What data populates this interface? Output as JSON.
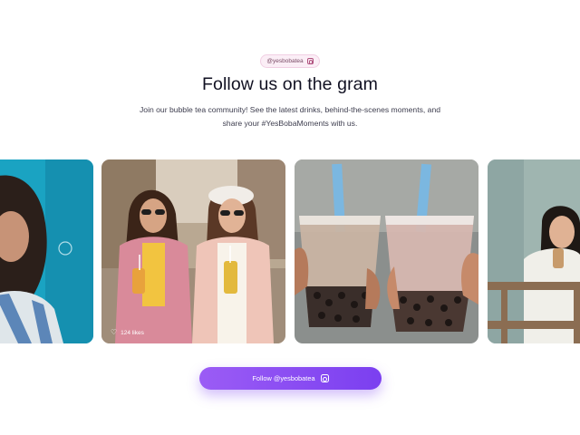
{
  "header": {
    "handle_badge": "@yesbobatea",
    "badge_icon": "instagram-icon",
    "title": "Follow us on the gram",
    "subtitle": "Join our bubble tea community! See the latest drinks, behind-the-scenes moments, and share your #YesBobaMoments with us."
  },
  "gallery": {
    "posts": [
      {
        "alt": "Woman with curly hair in denim overalls against teal background"
      },
      {
        "alt": "Two friends holding bubble tea drinks on a city street",
        "likes": "124 likes"
      },
      {
        "alt": "Two hands clinking milk bubble tea cups with blue straws"
      },
      {
        "alt": "Smiling woman drinking bubble tea near a wooden railing"
      }
    ],
    "like_icon": "heart-icon"
  },
  "cta": {
    "label": "Follow @yesbobatea",
    "icon": "instagram-icon",
    "color_start": "#9b5cf5",
    "color_end": "#7b3ff0"
  }
}
